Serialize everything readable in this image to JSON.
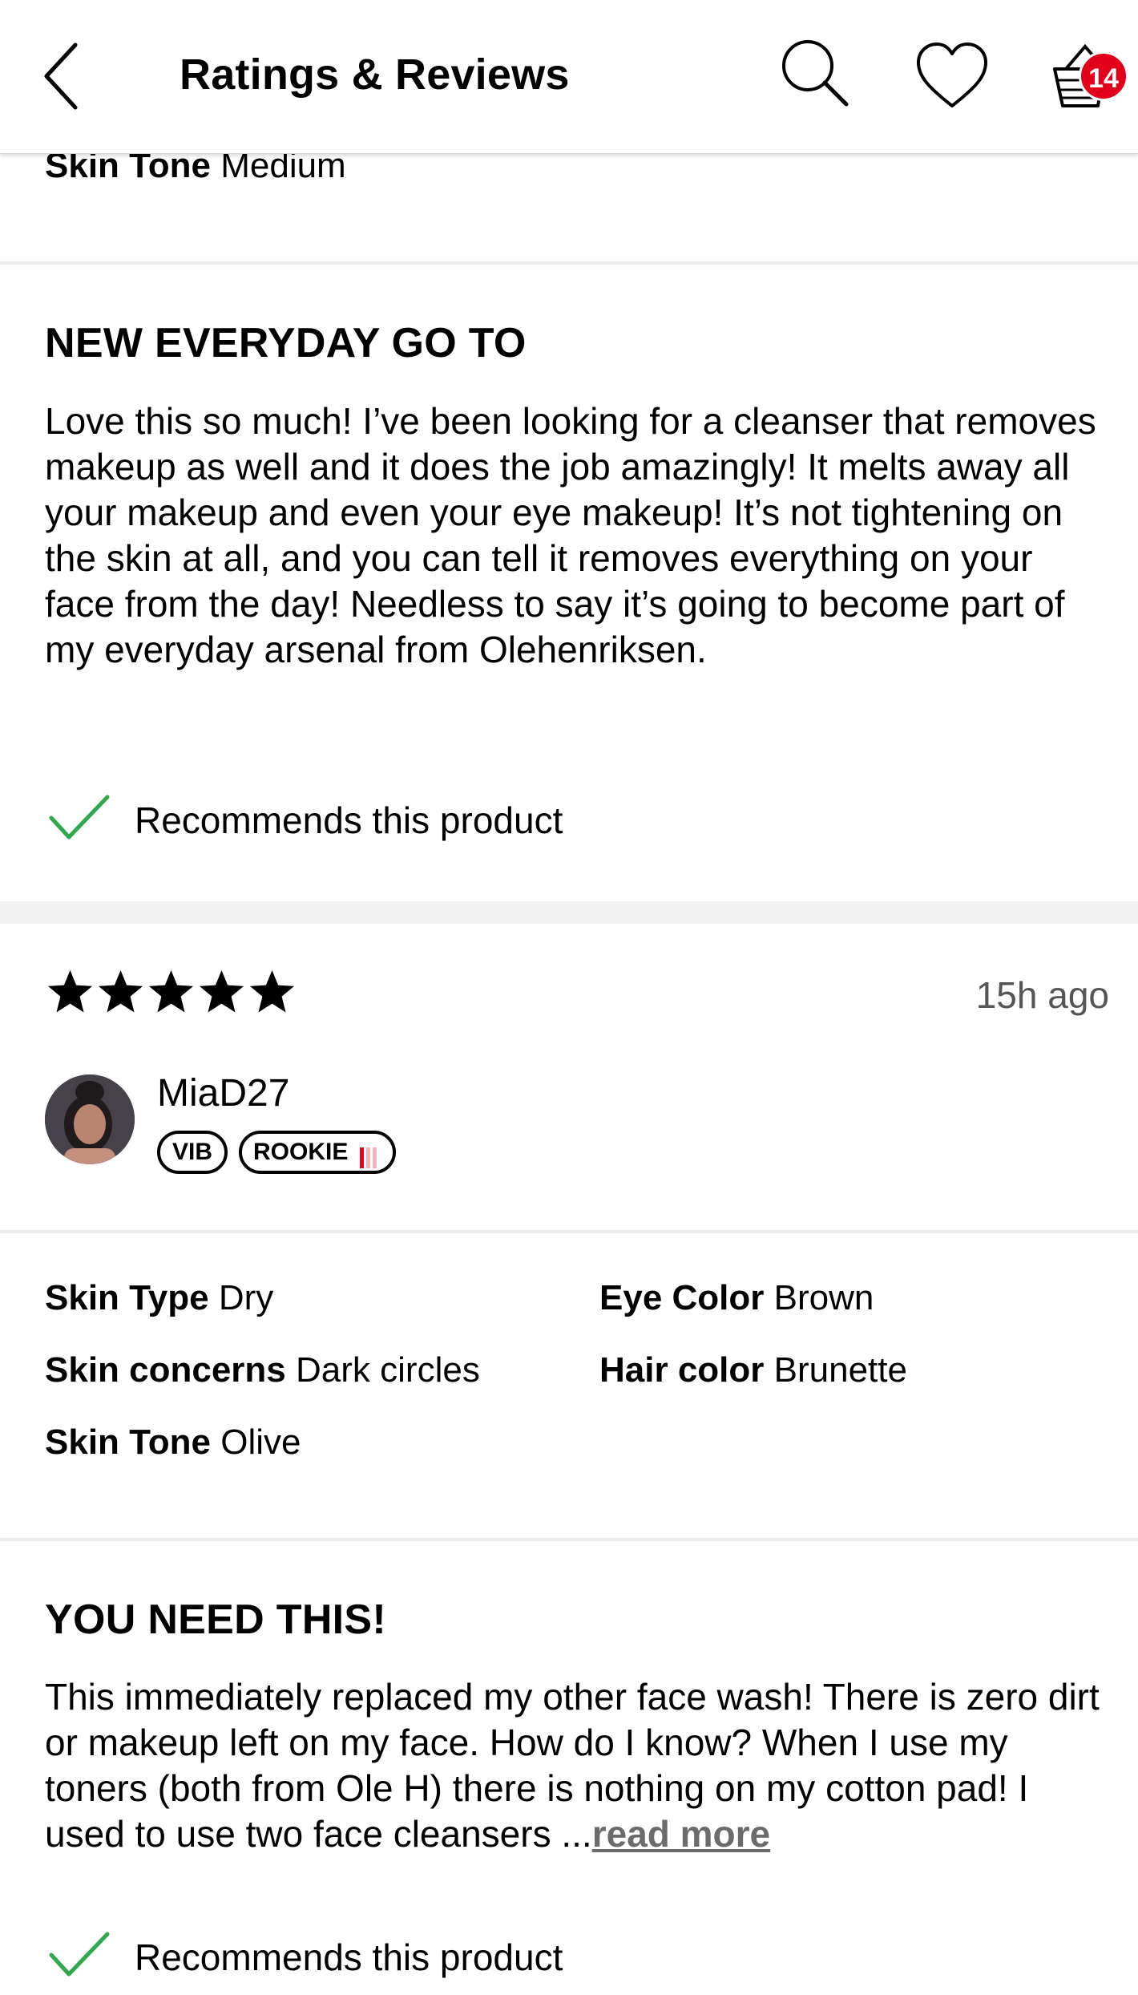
{
  "header": {
    "title": "Ratings & Reviews",
    "cart_count": "14"
  },
  "prev_review": {
    "skin_tone_label": "Skin Tone",
    "skin_tone_value": "Medium",
    "title": "NEW EVERYDAY GO TO",
    "body": "Love this so much! I’ve been looking for a cleanser that removes makeup as well and it does the job amazingly! It melts away all your makeup and even your eye makeup! It’s not tightening on the skin at all, and you can tell it removes everything on your face from the day! Needless to say it’s going to become part of my everyday arsenal from Olehenriksen.",
    "recommend_text": "Recommends this product"
  },
  "review": {
    "rating": 5,
    "time_ago": "15h ago",
    "username": "MiaD27",
    "badge_vib": "VIB",
    "badge_rookie": "ROOKIE",
    "attributes": {
      "skin_type_label": "Skin Type",
      "skin_type_value": "Dry",
      "eye_color_label": "Eye Color",
      "eye_color_value": "Brown",
      "skin_concerns_label": "Skin concerns",
      "skin_concerns_value": "Dark circles",
      "hair_color_label": "Hair color",
      "hair_color_value": "Brunette",
      "skin_tone_label": "Skin Tone",
      "skin_tone_value": "Olive"
    },
    "title": "YOU NEED THIS!",
    "body": "This immediately replaced my other face wash! There is zero dirt or makeup left on my face. How do I know? When I use my toners (both from Ole H) there is nothing on my cotton pad! I used to use two face cleansers ...",
    "read_more": "read more",
    "recommend_text": "Recommends this product"
  },
  "colors": {
    "accent_green": "#2fa84f",
    "badge_red": "#e2001a"
  },
  "icons": [
    "chevron-left-icon",
    "search-icon",
    "heart-icon",
    "basket-icon",
    "star-icon",
    "checkmark-icon"
  ]
}
